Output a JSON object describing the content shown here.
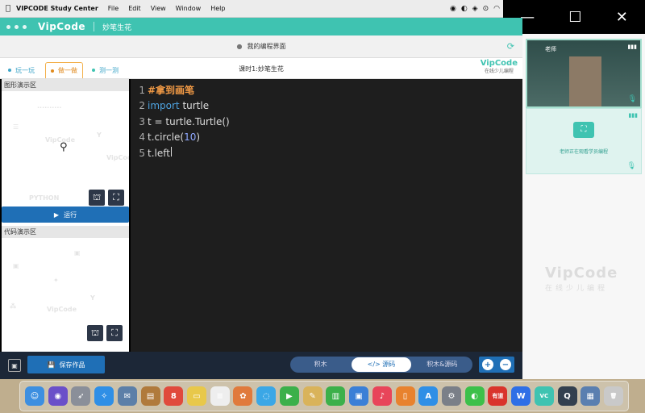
{
  "menubar": {
    "app_name": "VIPCODE Study Center",
    "items": [
      "File",
      "Edit",
      "View",
      "Window",
      "Help"
    ]
  },
  "window_controls": {
    "minimize": "—",
    "maximize": "☐",
    "close": "✕"
  },
  "header": {
    "logo": "VipCode",
    "title": "妙笔生花"
  },
  "subheader": {
    "title": "我的编程界面"
  },
  "tabs": [
    {
      "label": "玩一玩",
      "color": "#3fa6c9"
    },
    {
      "label": "做一做",
      "color": "#e08a1d"
    },
    {
      "label": "测一测",
      "color": "#3fc3b1"
    }
  ],
  "lesson_title": "课时1:妙笔生花",
  "brand": {
    "name": "VipCode",
    "tagline": "在线少儿编程"
  },
  "left_panel": {
    "graphics_title": "图形演示区",
    "run_label": "运行",
    "code_title": "代码演示区"
  },
  "editor": {
    "lines": [
      {
        "num": "1",
        "parts": [
          {
            "t": "#拿到画笔",
            "c": "cmt"
          }
        ]
      },
      {
        "num": "2",
        "parts": [
          {
            "t": "import",
            "c": "kw"
          },
          {
            "t": " turtle",
            "c": ""
          }
        ]
      },
      {
        "num": "3",
        "parts": [
          {
            "t": "t = turtle.Turtle()",
            "c": ""
          }
        ]
      },
      {
        "num": "4",
        "parts": [
          {
            "t": "t.circle(",
            "c": ""
          },
          {
            "t": "10",
            "c": "num"
          },
          {
            "t": ")",
            "c": ""
          }
        ]
      },
      {
        "num": "5",
        "parts": [
          {
            "t": "t.left",
            "c": ""
          }
        ]
      }
    ]
  },
  "bottom": {
    "save_label": "保存作品",
    "mode_blocks": "积木",
    "mode_code": "</> 源码",
    "mode_both": "积木&源码"
  },
  "right_panel": {
    "teacher_tag": "老师",
    "status_text": "老师正在观看学员编程",
    "watermark": "VipCode",
    "watermark_sub": "在线少儿编程"
  },
  "dock_icons": [
    {
      "name": "finder-icon",
      "color": "#3d8fe0",
      "glyph": "☺"
    },
    {
      "name": "siri-icon",
      "color": "#6a4fc9",
      "glyph": "◉"
    },
    {
      "name": "launchpad-icon",
      "color": "#8a8f99",
      "glyph": "➶"
    },
    {
      "name": "safari-icon",
      "color": "#2f8fe6",
      "glyph": "✧"
    },
    {
      "name": "mail-icon",
      "color": "#5c7fa8",
      "glyph": "✉"
    },
    {
      "name": "contacts-icon",
      "color": "#b07a3c",
      "glyph": "▤"
    },
    {
      "name": "calendar-icon",
      "color": "#e04a3c",
      "glyph": "8"
    },
    {
      "name": "notes-icon",
      "color": "#e8c84a",
      "glyph": "▭"
    },
    {
      "name": "reminders-icon",
      "color": "#eeeeee",
      "glyph": "≡"
    },
    {
      "name": "photos-icon",
      "color": "#e07a3c",
      "glyph": "✿"
    },
    {
      "name": "messages-icon",
      "color": "#3ba7e6",
      "glyph": "◌"
    },
    {
      "name": "facetime-icon",
      "color": "#3cb04a",
      "glyph": "▶"
    },
    {
      "name": "freeform-icon",
      "color": "#d9b35a",
      "glyph": "✎"
    },
    {
      "name": "numbers-icon",
      "color": "#3cb04a",
      "glyph": "▥"
    },
    {
      "name": "keynote-icon",
      "color": "#3b7fd6",
      "glyph": "▣"
    },
    {
      "name": "music-icon",
      "color": "#e8455a",
      "glyph": "♪"
    },
    {
      "name": "books-icon",
      "color": "#e8822e",
      "glyph": "▯"
    },
    {
      "name": "appstore-icon",
      "color": "#2f8fe6",
      "glyph": "A"
    },
    {
      "name": "settings-icon",
      "color": "#7a7f88",
      "glyph": "⚙"
    },
    {
      "name": "wechat-icon",
      "color": "#3cc04a",
      "glyph": "◐"
    },
    {
      "name": "youdao-icon",
      "color": "#d9342c",
      "glyph": "有道"
    },
    {
      "name": "wps-icon",
      "color": "#2f6fe6",
      "glyph": "W"
    },
    {
      "name": "vipcode-icon",
      "color": "#3fc3b1",
      "glyph": "VC"
    },
    {
      "name": "quicktime-icon",
      "color": "#33404f",
      "glyph": "Q"
    },
    {
      "name": "preview-icon",
      "color": "#5a7fb0",
      "glyph": "▦"
    },
    {
      "name": "trash-icon",
      "color": "#c9c9c9",
      "glyph": "🗑"
    }
  ]
}
